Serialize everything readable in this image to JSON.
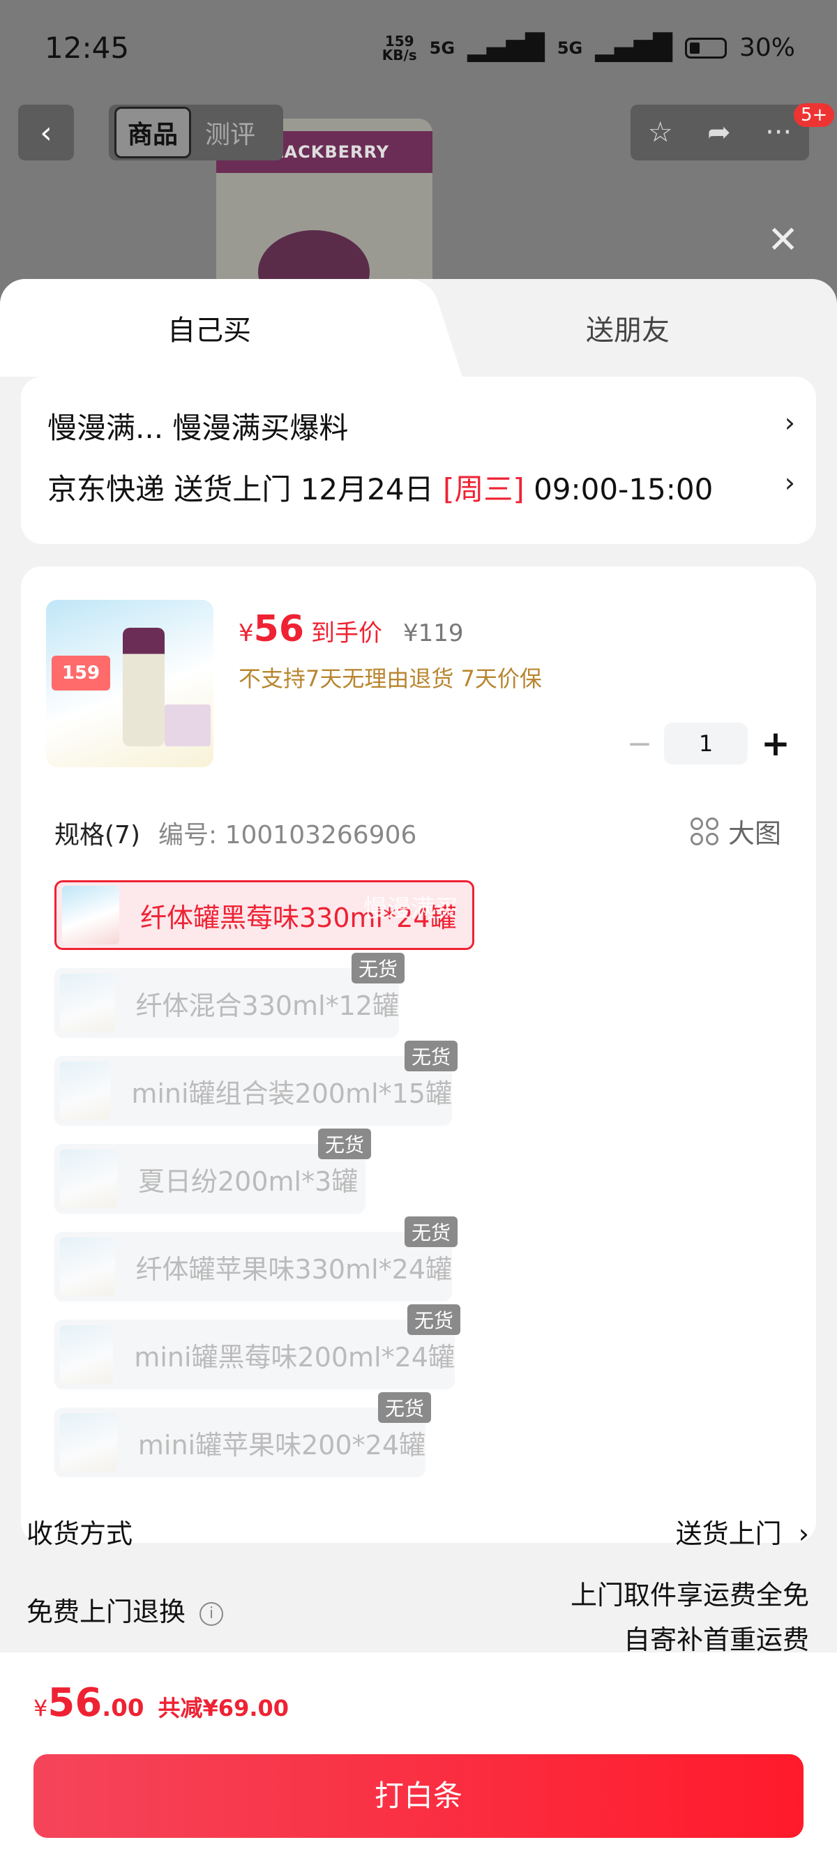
{
  "status": {
    "time": "12:45",
    "speed_top": "159",
    "speed_unit": "KB/s",
    "net1": "5G",
    "net2": "5G",
    "battery": "30%"
  },
  "header": {
    "tab_product": "商品",
    "tab_review": "测评",
    "badge": "5+",
    "can_text": "BLACKBERRY"
  },
  "sheet": {
    "tab_self": "自己买",
    "tab_friend": "送朋友"
  },
  "address": {
    "line1": "慢漫满...  慢漫满买爆料",
    "delivery_prefix": "京东快递 送货上门 12月24日 ",
    "weekday": "[周三]",
    "delivery_time": " 09:00-15:00"
  },
  "product": {
    "thumb_price": "159",
    "currency": "¥",
    "price": "56",
    "price_label": "到手价",
    "original_price": "¥119",
    "policy": "不支持7天无理由退货  7天价保",
    "quantity": "1",
    "minus": "−",
    "plus": "+"
  },
  "spec": {
    "title": "规格(7)",
    "number": "编号: 100103266906",
    "big_image": "大图",
    "watermark": "慢漫满买",
    "sold_out": "无货",
    "options": [
      {
        "label": "纤体罐黑莓味330ml*24罐",
        "selected": true
      },
      {
        "label": "纤体混合330ml*12罐",
        "selected": false
      },
      {
        "label": "mini罐组合装200ml*15罐",
        "selected": false
      },
      {
        "label": "夏日纷200ml*3罐",
        "selected": false
      },
      {
        "label": "纤体罐苹果味330ml*24罐",
        "selected": false
      },
      {
        "label": "mini罐黑莓味200ml*24罐",
        "selected": false
      },
      {
        "label": "mini罐苹果味200*24罐",
        "selected": false
      }
    ]
  },
  "shipping": {
    "method_label": "收货方式",
    "method_value": "送货上门",
    "return_label": "免费上门退换",
    "return_line1": "上门取件享运费全免",
    "return_line2": "自寄补首重运费"
  },
  "footer": {
    "currency": "¥",
    "total_int": "56",
    "total_dec": ".00",
    "savings": "共减¥69.00",
    "pay_button": "打白条"
  },
  "colors": {
    "accent": "#e8232f",
    "policy": "#b8862f"
  }
}
